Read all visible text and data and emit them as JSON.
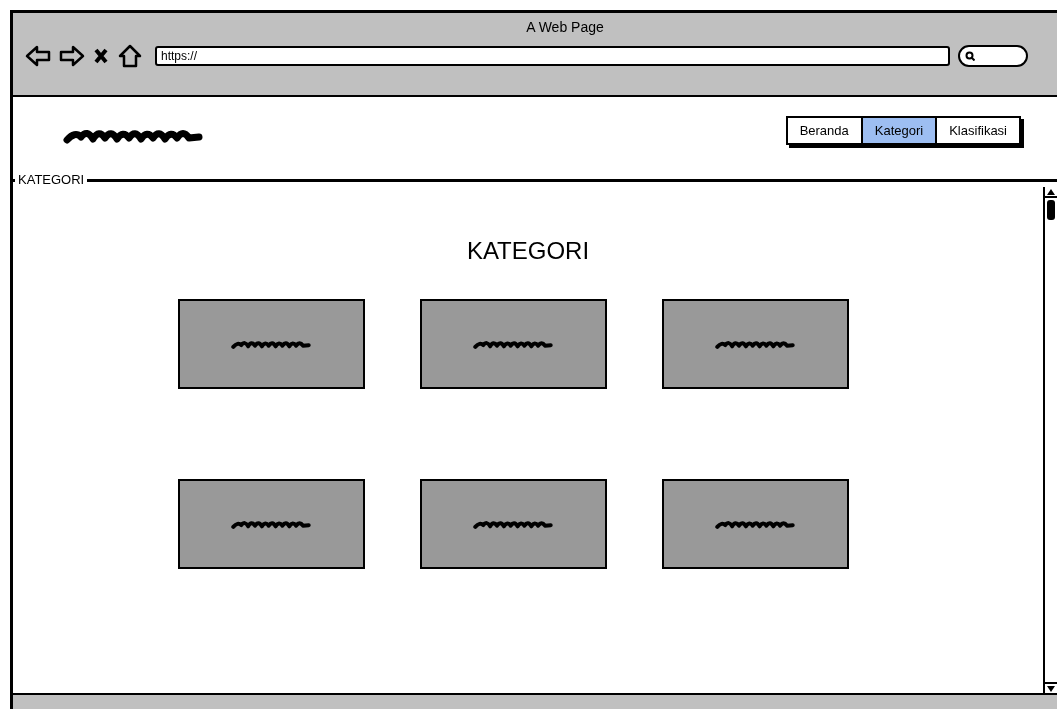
{
  "window": {
    "title": "A Web Page"
  },
  "address_bar": {
    "value": "https://"
  },
  "nav_tabs": [
    {
      "label": "Beranda",
      "selected": false
    },
    {
      "label": "Kategori",
      "selected": true
    },
    {
      "label": "Klasifikasi",
      "selected": false
    }
  ],
  "section": {
    "legend": "KATEGORI",
    "heading": "KATEGORI",
    "cards": [
      {
        "kind": "scribble"
      },
      {
        "kind": "scribble"
      },
      {
        "kind": "scribble"
      },
      {
        "kind": "scribble"
      },
      {
        "kind": "scribble"
      },
      {
        "kind": "scribble"
      }
    ]
  }
}
